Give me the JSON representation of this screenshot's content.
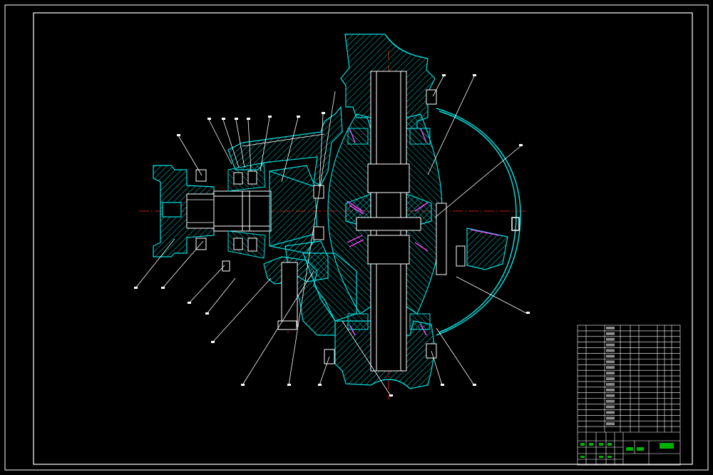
{
  "colors": {
    "background": "#000000",
    "frame": "#ffffff",
    "housing": "#00e0e0",
    "hatch": "#00d8d8",
    "centerline": "#ff2020",
    "bearing_roller": "#ff40ff",
    "leader": "#ffffff",
    "title_text": "#00e000"
  },
  "drawing": {
    "type": "assembly-section",
    "subject": "drive-axle-final-drive-section",
    "balloon_count": 22
  },
  "title_block": {
    "parts_list_rows": 19,
    "drawing_title": "",
    "sheet_labels": []
  }
}
